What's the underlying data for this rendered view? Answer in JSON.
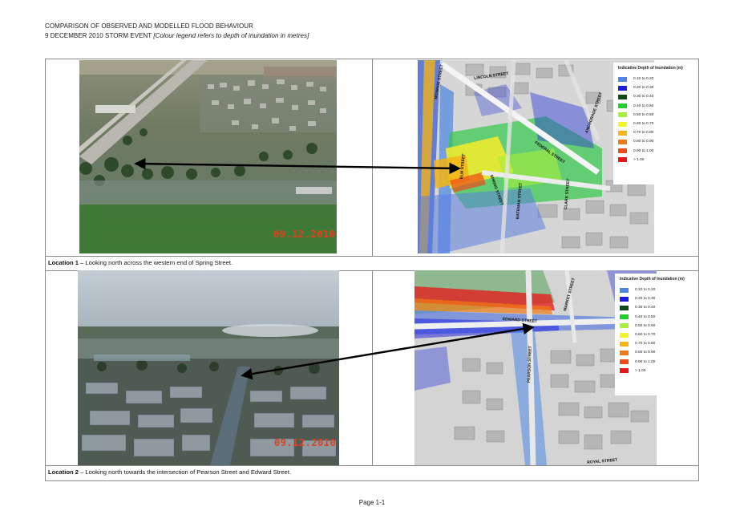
{
  "header": {
    "line1": "COMPARISON OF OBSERVED AND MODELLED FLOOD BEHAVIOUR",
    "line2_main": "9 DECEMBER 2010 STORM EVENT ",
    "line2_italic": "[Colour legend refers to depth of inundation in metres]"
  },
  "locations": [
    {
      "label": "Location 1",
      "description": " – Looking north across the western end of Spring Street.",
      "photo_stamp": "09.12.2010",
      "streets": [
        "SPRING STREET",
        "ELM STREET",
        "BATEMAN STREET",
        "CLARK STREET",
        "FEDERAL STREET",
        "LINCOLN STREET",
        "MONROE STREET",
        "ANCHORAGE STREET"
      ]
    },
    {
      "label": "Location 2",
      "description": " – Looking north towards the intersection of Pearson Street and Edward Street.",
      "photo_stamp": "09.12.2010",
      "streets": [
        "EDWARD STREET",
        "PEARSON STREET",
        "MARKET STREET",
        "ROYAL STREET"
      ]
    }
  ],
  "legend": {
    "title": "Indicative Depth of Inundation (m)",
    "items": [
      {
        "label": "0.10 to 0.20",
        "color": "#4f86e6"
      },
      {
        "label": "0.20 to 0.30",
        "color": "#1a1ae0"
      },
      {
        "label": "0.30 to 0.40",
        "color": "#0c4a12"
      },
      {
        "label": "0.40 to 0.50",
        "color": "#1fcf2a"
      },
      {
        "label": "0.50 to 0.60",
        "color": "#a6ef3a"
      },
      {
        "label": "0.60 to 0.70",
        "color": "#f4f42a"
      },
      {
        "label": "0.70 to 0.80",
        "color": "#f5b418"
      },
      {
        "label": "0.80 to 0.90",
        "color": "#f07a14"
      },
      {
        "label": "0.90 to 1.00",
        "color": "#ef4a18"
      },
      {
        "label": "> 1.00",
        "color": "#e81616"
      }
    ]
  },
  "footer": {
    "page": "Page 1-1"
  }
}
